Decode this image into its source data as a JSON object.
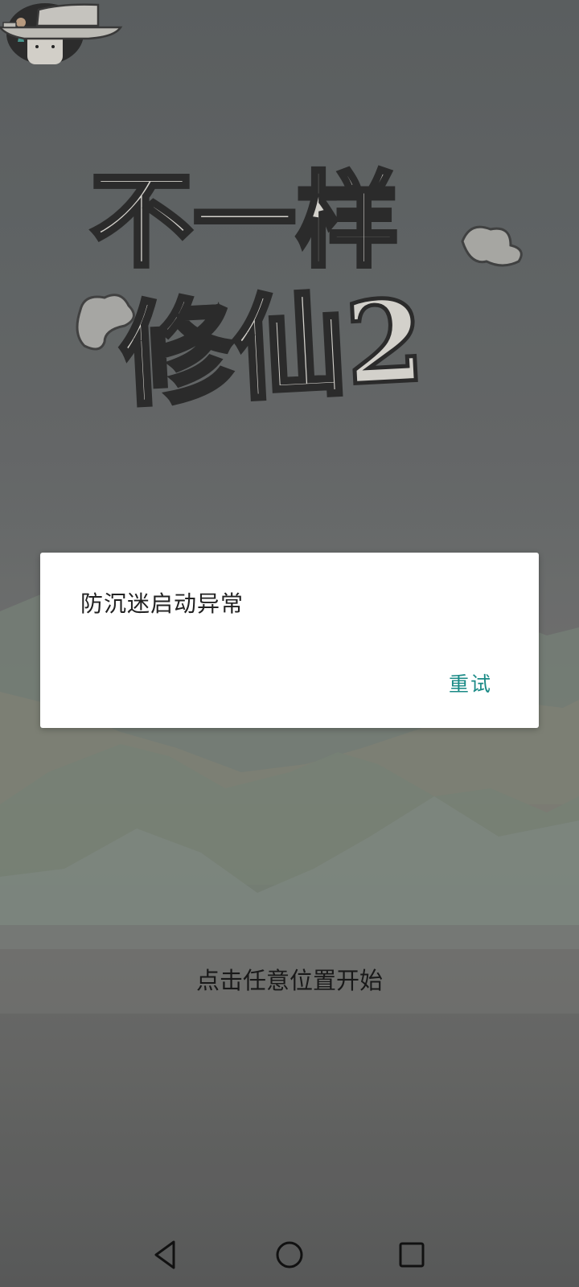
{
  "game": {
    "title_line1": "不一样",
    "title_line2": "修仙2",
    "tap_to_start": "点击任意位置开始"
  },
  "dialog": {
    "message": "防沉迷启动异常",
    "retry_label": "重试"
  },
  "navbar": {
    "back_icon": "back-triangle-icon",
    "home_icon": "home-circle-icon",
    "recents_icon": "recents-square-icon"
  },
  "colors": {
    "retry": "#1a8a86",
    "dialog_bg": "#ffffff"
  }
}
